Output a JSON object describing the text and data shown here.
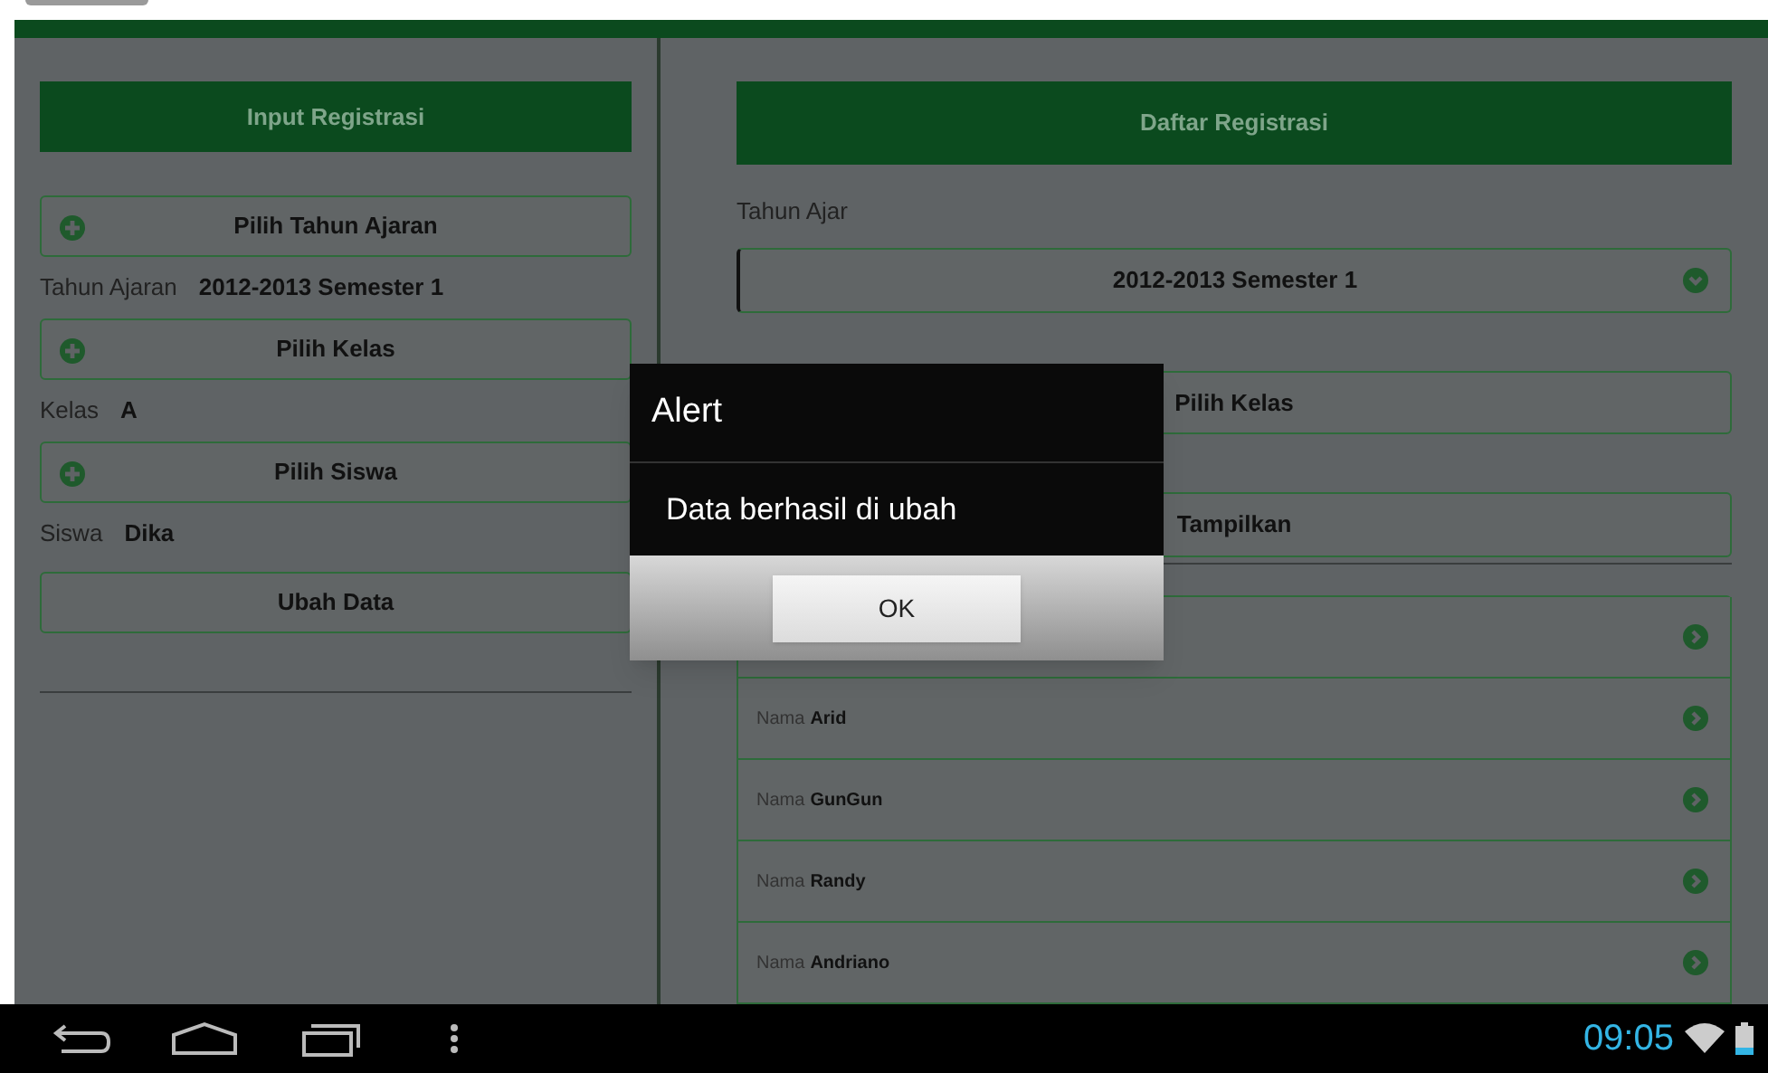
{
  "left_panel": {
    "header": "Input Registrasi",
    "sections": [
      {
        "button": "Pilih Tahun Ajaran",
        "label": "Tahun Ajaran",
        "value": "2012-2013 Semester 1"
      },
      {
        "button": "Pilih Kelas",
        "label": "Kelas",
        "value": "A"
      },
      {
        "button": "Pilih Siswa",
        "label": "Siswa",
        "value": "Dika"
      }
    ],
    "submit": "Ubah Data"
  },
  "right_panel": {
    "header": "Daftar Registrasi",
    "year_label": "Tahun Ajar",
    "year_select": "2012-2013  Semester 1",
    "class_button": "Pilih Kelas",
    "show_button": "Tampilkan",
    "students": [
      {
        "kind": "covered"
      },
      {
        "kind": "student",
        "label": "Nama",
        "name": "Arid"
      },
      {
        "kind": "student",
        "label": "Nama",
        "name": "GunGun"
      },
      {
        "kind": "student",
        "label": "Nama",
        "name": "Randy"
      },
      {
        "kind": "student",
        "label": "Nama",
        "name": "Andriano"
      }
    ]
  },
  "dialog": {
    "title": "Alert",
    "message": "Data berhasil di ubah",
    "button": "OK"
  },
  "status_bar": {
    "time": "09:05"
  }
}
